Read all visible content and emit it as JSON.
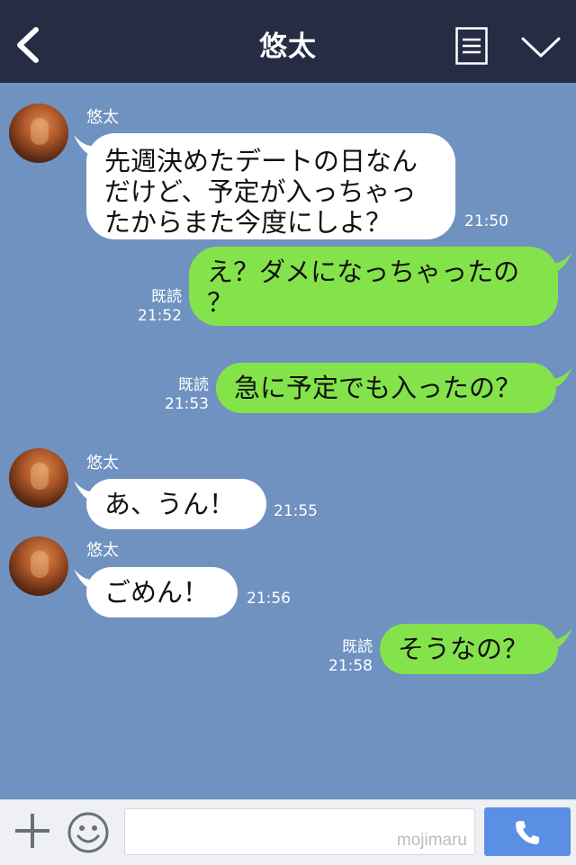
{
  "header": {
    "title": "悠太",
    "back_icon": "chevron-left-icon",
    "menu_icon": "list-icon",
    "collapse_icon": "chevron-down-icon"
  },
  "messages": [
    {
      "direction": "in",
      "sender": "悠太",
      "lines": [
        "先週決めたデートの日なん",
        "だけど、予定が入っちゃっ",
        "たからまた今度にしよ？"
      ],
      "time": "21:50"
    },
    {
      "direction": "out",
      "read": "既読",
      "lines": [
        "え？ダメになっちゃったの",
        "？"
      ],
      "time": "21:52"
    },
    {
      "direction": "out",
      "read": "既読",
      "lines": [
        "急に予定でも入ったの？"
      ],
      "time": "21:53"
    },
    {
      "direction": "in",
      "sender": "悠太",
      "lines": [
        "あ、うん！"
      ],
      "time": "21:55"
    },
    {
      "direction": "in",
      "sender": "悠太",
      "lines": [
        "ごめん！"
      ],
      "time": "21:56"
    },
    {
      "direction": "out",
      "read": "既読",
      "lines": [
        "そうなの？"
      ],
      "time": "21:58"
    }
  ],
  "footer": {
    "input_watermark": "mojimaru",
    "plus_icon": "plus-icon",
    "emoji_icon": "smiley-icon",
    "call_icon": "phone-icon"
  },
  "colors": {
    "header_bg": "#252c43",
    "chat_bg": "#6f92c1",
    "outgoing_bubble": "#84e34a",
    "incoming_bubble": "#ffffff",
    "call_button": "#5b8fe3"
  }
}
